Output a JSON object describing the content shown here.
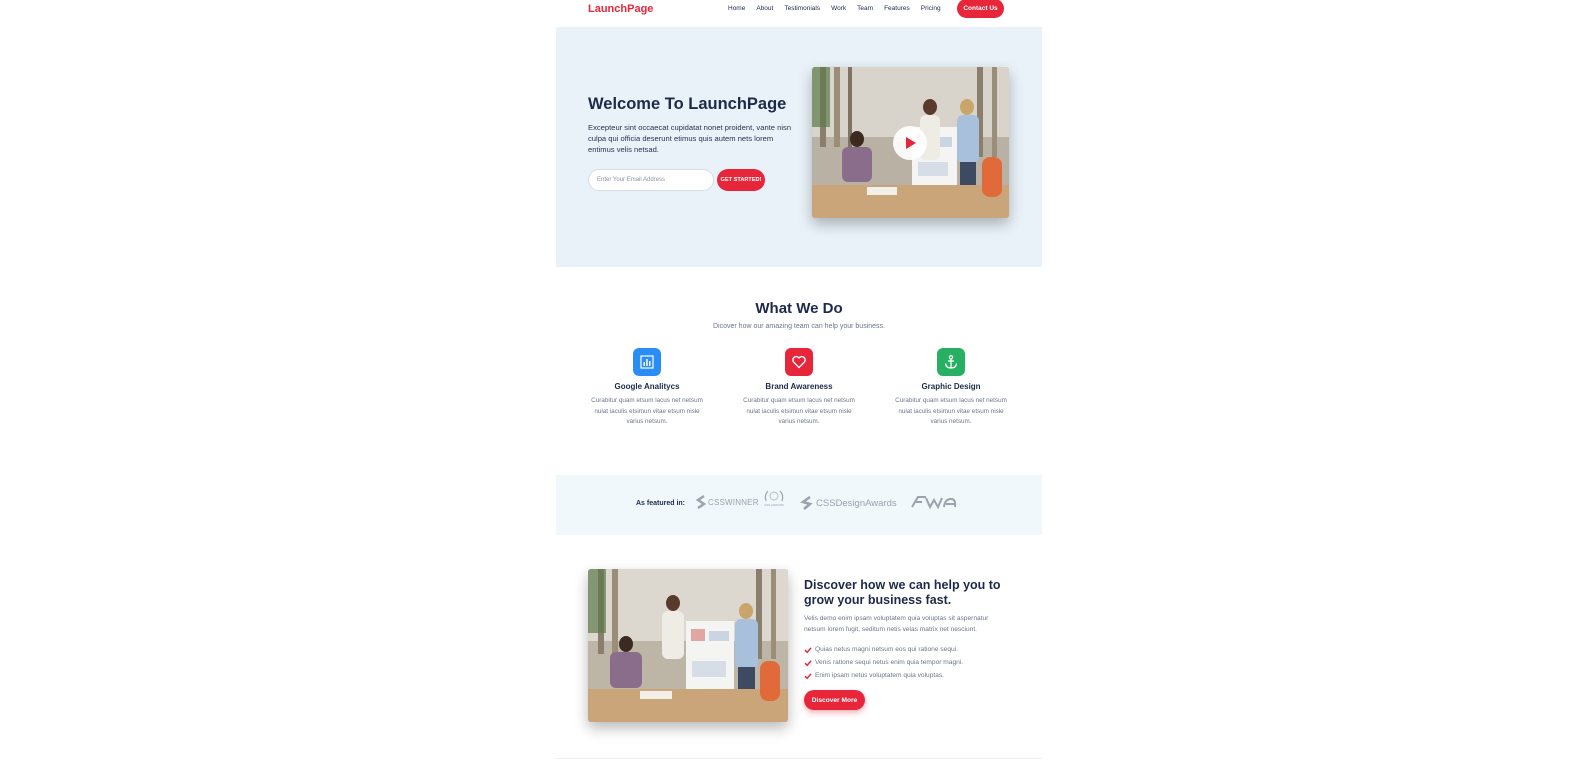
{
  "nav": {
    "logo": "LaunchPage",
    "links": [
      "Home",
      "About",
      "Testimonials",
      "Work",
      "Team",
      "Features",
      "Pricing"
    ],
    "cta": "Contact Us"
  },
  "hero": {
    "title": "Welcome To LaunchPage",
    "text": "Excepteur sint occaecat cupidatat nonet proident, vante nisn culpa qui officia deserunt etimus quis autem nets lorem entimus velis netsad.",
    "email_placeholder": "Enter Your Email Address",
    "button": "GET STARTED!",
    "play_icon": "play-icon"
  },
  "services": {
    "title": "What We Do",
    "subtitle": "Dicover how our amazing team can help your business.",
    "items": [
      {
        "icon": "bar-chart-icon",
        "color": "#2a8cf5",
        "title": "Google Analitycs",
        "text": "Curabitur quam etsum lacus net netsum nulat iaculis etsimun vitae etsum nisle varius netsum."
      },
      {
        "icon": "heart-icon",
        "color": "#e8263a",
        "title": "Brand Awareness",
        "text": "Curabitur quam etsum lacus net netsum nulat iaculis etsimun vitae etsum nisle varius netsum."
      },
      {
        "icon": "anchor-icon",
        "color": "#27b062",
        "title": "Graphic Design",
        "text": "Curabitur quam etsum lacus net netsum nulat iaculis etsimun vitae etsum nisle varius netsum."
      }
    ]
  },
  "featured": {
    "label": "As featured in:",
    "logos": [
      "CSSWINNER",
      "CSS AWARDS",
      "CSSDesignAwards",
      "FWA"
    ]
  },
  "discover": {
    "title": "Discover how we can help you to grow your business fast.",
    "text": "Velis demo enim ipsam voluptatem quia voluptas sit aspernatur netsum lorem fugit, seditum netis velas matrix net nesciunt.",
    "items": [
      "Quias netus magni netsum eos qui ratione sequi.",
      "Venis ratione sequi netus enim quia tempor magni.",
      "Enim ipsam netus voluptatem quia voluptas."
    ],
    "button": "Discover More"
  },
  "colors": {
    "accent": "#e8263a",
    "navy": "#1e2a4a",
    "hero_bg": "#e8f2f8"
  }
}
